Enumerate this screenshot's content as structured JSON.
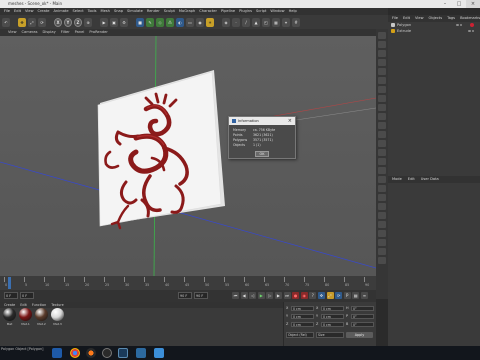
{
  "window": {
    "title": "meshes - Scene_ok* - Main"
  },
  "menubar": {
    "items": [
      "File",
      "Edit",
      "View",
      "Create",
      "Animate",
      "Select",
      "Tools",
      "Mesh",
      "Snap",
      "Simulate",
      "Render",
      "Sculpt",
      "MoGraph",
      "Character",
      "Pipeline",
      "Plugins",
      "Script",
      "Window",
      "Help"
    ]
  },
  "right_menu": {
    "items": [
      "File",
      "Edit",
      "View",
      "Objects",
      "Tags",
      "Bookmarks"
    ]
  },
  "toolbar": {
    "axis_x": "X",
    "axis_y": "Y",
    "axis_z": "Z"
  },
  "viewport": {
    "menu": [
      "View",
      "Cameras",
      "Display",
      "Filter",
      "Panel",
      "ProRender"
    ],
    "perspective_label": "Perspective"
  },
  "objects": {
    "rows": [
      {
        "name": "Polygon",
        "color": "#c7c7c7"
      },
      {
        "name": "Extrude",
        "color": "#d4a017"
      }
    ]
  },
  "attributes": {
    "menu": [
      "Mode",
      "Edit",
      "User Data"
    ]
  },
  "timeline": {
    "labels": [
      "0",
      "5",
      "10",
      "15",
      "20",
      "25",
      "30",
      "35",
      "40",
      "45",
      "50",
      "55",
      "60",
      "65",
      "70",
      "75",
      "80",
      "85",
      "90"
    ]
  },
  "transport": {
    "start": "0 F",
    "current": "0 F",
    "end": "90 F",
    "end2": "90 F"
  },
  "materials": {
    "menu": [
      "Create",
      "Edit",
      "Function",
      "Texture"
    ],
    "items": [
      {
        "label": "Mat",
        "color": "#2a2a2a"
      },
      {
        "label": "Mat.1",
        "color": "#7a1414"
      },
      {
        "label": "Mat.2",
        "color": "#5a3b2a"
      },
      {
        "label": "Mat.3",
        "color": "#d9d9d9"
      }
    ]
  },
  "coordinates": {
    "position": {
      "x": "0 cm",
      "y": "0 cm",
      "z": "0 cm"
    },
    "size": {
      "x": "0 cm",
      "y": "0 cm",
      "z": "0 cm"
    },
    "rotation": {
      "h": "0°",
      "p": "0°",
      "b": "0°"
    },
    "mode": "Object (Rel)",
    "size_mode": "Size",
    "apply_label": "Apply"
  },
  "info_dialog": {
    "title": "Information",
    "rows": [
      {
        "key": "Memory",
        "value": "ca. 756 KByte"
      },
      {
        "key": "Points",
        "value": "3621 (3621)"
      },
      {
        "key": "Polygons",
        "value": "3571 (3571)"
      },
      {
        "key": "Objects",
        "value": "1 (1)"
      }
    ],
    "ok_label": "OK"
  },
  "status_text": "Polygon Object [Polygon]",
  "colors": {
    "accent": "#3b6fb0",
    "relief": "#8b1a1a",
    "plate": "#f2f2f2"
  }
}
